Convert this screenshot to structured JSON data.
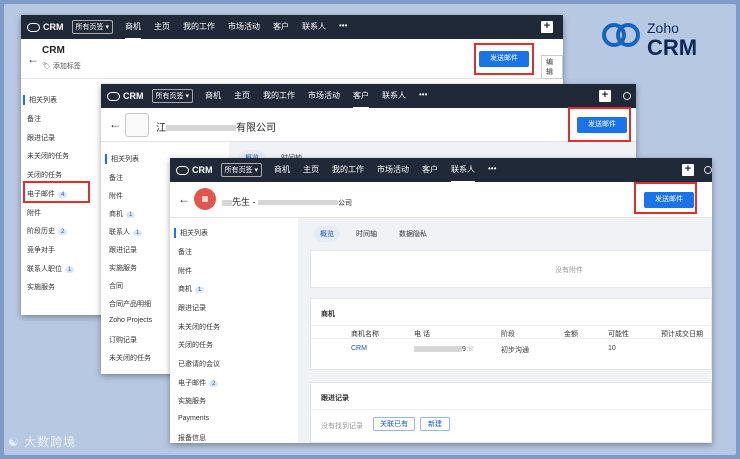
{
  "logo": {
    "word1": "Zoho",
    "word2": "CRM"
  },
  "watermark": "大数跨境",
  "win1": {
    "brand": "CRM",
    "pages": "所有页签 ▾",
    "nav": [
      "商机",
      "主页",
      "我的工作",
      "市场活动",
      "客户",
      "联系人",
      "•••"
    ],
    "active": 0,
    "title": "CRM",
    "tag": "添加标签",
    "send": "发送邮件",
    "edit": "编辑",
    "related_header": "相关列表",
    "related": [
      {
        "label": "备注"
      },
      {
        "label": "跟进记录"
      },
      {
        "label": "未关闭的任务"
      },
      {
        "label": "关闭的任务"
      },
      {
        "label": "电子邮件",
        "count": "4"
      },
      {
        "label": "附件"
      },
      {
        "label": "阶段历史",
        "count": "2"
      },
      {
        "label": "竞争对手"
      },
      {
        "label": "联系人职位",
        "count": "1"
      },
      {
        "label": "实施服务"
      }
    ]
  },
  "win2": {
    "brand": "CRM",
    "pages": "所有页签 ▾",
    "nav": [
      "商机",
      "主页",
      "我的工作",
      "市场活动",
      "客户",
      "联系人",
      "•••"
    ],
    "active": 4,
    "title_pre": "江",
    "title_post": "有限公司",
    "send": "发送邮件",
    "tabs": [
      "概览",
      "时间轴"
    ],
    "related_header": "相关列表",
    "related": [
      {
        "label": "备注"
      },
      {
        "label": "附件"
      },
      {
        "label": "商机",
        "count": "1"
      },
      {
        "label": "联系人",
        "count": "1"
      },
      {
        "label": "跟进记录"
      },
      {
        "label": "实施服务"
      },
      {
        "label": "合同"
      },
      {
        "label": "合同产品明细"
      },
      {
        "label": "Zoho Projects"
      },
      {
        "label": "订购记录"
      },
      {
        "label": "未关闭的任务"
      }
    ]
  },
  "win3": {
    "brand": "CRM",
    "pages": "所有页签 ▾",
    "nav": [
      "商机",
      "主页",
      "我的工作",
      "市场活动",
      "客户",
      "联系人",
      "•••"
    ],
    "active": 5,
    "name": "先生",
    "company_suffix": "公司",
    "send": "发送邮件",
    "tabs": [
      "概览",
      "时间轴",
      "数据隐私"
    ],
    "related_header": "相关列表",
    "related": [
      {
        "label": "备注"
      },
      {
        "label": "附件"
      },
      {
        "label": "商机",
        "count": "1"
      },
      {
        "label": "跟进记录"
      },
      {
        "label": "未关闭的任务"
      },
      {
        "label": "关闭的任务"
      },
      {
        "label": "已邀请的会议"
      },
      {
        "label": "电子邮件",
        "count": "2"
      },
      {
        "label": "实施服务"
      },
      {
        "label": "Payments"
      },
      {
        "label": "报备信息"
      }
    ],
    "no_attach": "没有附件",
    "deals": {
      "title": "商机",
      "cols": [
        "商机名称",
        "电 话",
        "阶段",
        "金额",
        "可能性",
        "预计成交日期"
      ],
      "row": {
        "name": "CRM",
        "phone_suffix": "9",
        "stage": "初步沟通",
        "amount": "",
        "prob": "10",
        "date": ""
      }
    },
    "followup": {
      "title": "跟进记录",
      "empty": "没有找到记录",
      "link": "关联已有",
      "new": "新建"
    }
  }
}
